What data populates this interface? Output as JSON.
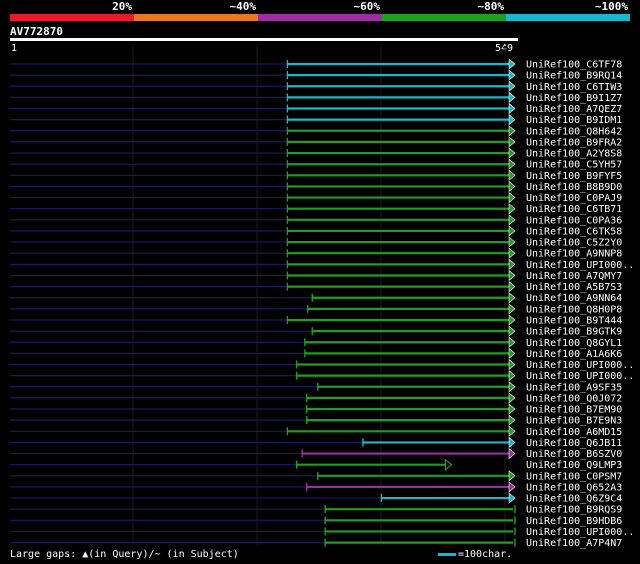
{
  "legend": {
    "segments": [
      {
        "label": "20%",
        "color": "#e8192c"
      },
      {
        "label": "~40%",
        "color": "#e87722"
      },
      {
        "label": "~60%",
        "color": "#9b2fa0"
      },
      {
        "label": "~80%",
        "color": "#1f9e1f"
      },
      {
        "label": "~100%",
        "color": "#17b8c8"
      }
    ]
  },
  "query": {
    "name": "AV772870",
    "start": "1",
    "end": "549"
  },
  "colors": {
    "connector": "#1a1a66",
    "cyan": "#17b8c8",
    "green": "#1f9e1f",
    "purple": "#9b2fa0"
  },
  "hits": [
    {
      "label": "UniRef100_C6TF78",
      "color": "cyan",
      "start": 302,
      "end": 549,
      "end_marker": "arrow"
    },
    {
      "label": "UniRef100_B9RQ14",
      "color": "cyan",
      "start": 302,
      "end": 549,
      "end_marker": "arrow"
    },
    {
      "label": "UniRef100_C6TIW3",
      "color": "cyan",
      "start": 302,
      "end": 549,
      "end_marker": "arrow"
    },
    {
      "label": "UniRef100_B9I1Z7",
      "color": "cyan",
      "start": 302,
      "end": 549,
      "end_marker": "arrow"
    },
    {
      "label": "UniRef100_A7QEZ7",
      "color": "cyan",
      "start": 302,
      "end": 549,
      "end_marker": "arrow"
    },
    {
      "label": "UniRef100_B9IDM1",
      "color": "cyan",
      "start": 302,
      "end": 549,
      "end_marker": "arrow"
    },
    {
      "label": "UniRef100_Q8H642",
      "color": "green",
      "start": 302,
      "end": 549,
      "end_marker": "arrow"
    },
    {
      "label": "UniRef100_B9FRA2",
      "color": "green",
      "start": 302,
      "end": 549,
      "end_marker": "arrow"
    },
    {
      "label": "UniRef100_A2Y8S8",
      "color": "green",
      "start": 302,
      "end": 549,
      "end_marker": "arrow"
    },
    {
      "label": "UniRef100_C5YH57",
      "color": "green",
      "start": 302,
      "end": 549,
      "end_marker": "arrow"
    },
    {
      "label": "UniRef100_B9FYF5",
      "color": "green",
      "start": 302,
      "end": 549,
      "end_marker": "arrow"
    },
    {
      "label": "UniRef100_B8B9D0",
      "color": "green",
      "start": 302,
      "end": 549,
      "end_marker": "arrow"
    },
    {
      "label": "UniRef100_C0PAJ9",
      "color": "green",
      "start": 302,
      "end": 549,
      "end_marker": "arrow"
    },
    {
      "label": "UniRef100_C6TB71",
      "color": "green",
      "start": 302,
      "end": 549,
      "end_marker": "arrow"
    },
    {
      "label": "UniRef100_C0PA36",
      "color": "green",
      "start": 302,
      "end": 549,
      "end_marker": "arrow"
    },
    {
      "label": "UniRef100_C6TK58",
      "color": "green",
      "start": 302,
      "end": 549,
      "end_marker": "arrow"
    },
    {
      "label": "UniRef100_C5Z2Y0",
      "color": "green",
      "start": 302,
      "end": 549,
      "end_marker": "arrow"
    },
    {
      "label": "UniRef100_A9NNP8",
      "color": "green",
      "start": 302,
      "end": 549,
      "end_marker": "arrow"
    },
    {
      "label": "UniRef100_UPI000..",
      "color": "green",
      "start": 302,
      "end": 549,
      "end_marker": "arrow"
    },
    {
      "label": "UniRef100_A7QMY7",
      "color": "green",
      "start": 302,
      "end": 549,
      "end_marker": "arrow"
    },
    {
      "label": "UniRef100_A5B7S3",
      "color": "green",
      "start": 302,
      "end": 549,
      "end_marker": "arrow"
    },
    {
      "label": "UniRef100_A9NN64",
      "color": "green",
      "start": 329,
      "end": 549,
      "end_marker": "arrow"
    },
    {
      "label": "UniRef100_Q8H0P8",
      "color": "green",
      "start": 324,
      "end": 549,
      "end_marker": "arrow"
    },
    {
      "label": "UniRef100_B9T444",
      "color": "green",
      "start": 302,
      "end": 549,
      "end_marker": "arrow"
    },
    {
      "label": "UniRef100_B9GTK9",
      "color": "green",
      "start": 329,
      "end": 549,
      "end_marker": "arrow"
    },
    {
      "label": "UniRef100_Q8GYL1",
      "color": "green",
      "start": 321,
      "end": 549,
      "end_marker": "arrow"
    },
    {
      "label": "UniRef100_A1A6K6",
      "color": "green",
      "start": 321,
      "end": 549,
      "end_marker": "arrow"
    },
    {
      "label": "UniRef100_UPI000..",
      "color": "green",
      "start": 312,
      "end": 549,
      "end_marker": "arrow"
    },
    {
      "label": "UniRef100_UPI000..",
      "color": "green",
      "start": 312,
      "end": 549,
      "end_marker": "arrow"
    },
    {
      "label": "UniRef100_A9SF35",
      "color": "green",
      "start": 335,
      "end": 549,
      "end_marker": "arrow"
    },
    {
      "label": "UniRef100_Q0J072",
      "color": "green",
      "start": 323,
      "end": 549,
      "end_marker": "arrow"
    },
    {
      "label": "UniRef100_B7EM90",
      "color": "green",
      "start": 323,
      "end": 549,
      "end_marker": "arrow"
    },
    {
      "label": "UniRef100_B7E9N3",
      "color": "green",
      "start": 323,
      "end": 549,
      "end_marker": "arrow"
    },
    {
      "label": "UniRef100_A6MD15",
      "color": "green",
      "start": 302,
      "end": 549,
      "end_marker": "arrow"
    },
    {
      "label": "UniRef100_Q6JB11",
      "color": "cyan",
      "start": 384,
      "end": 549,
      "end_marker": "arrow"
    },
    {
      "label": "UniRef100_B6SZV0",
      "color": "purple",
      "start": 318,
      "end": 549,
      "end_marker": "arrow"
    },
    {
      "label": "UniRef100_Q9LMP3",
      "color": "green",
      "start": 312,
      "end": 480,
      "end_marker": "open-arrow"
    },
    {
      "label": "UniRef100_C0PSM7",
      "color": "green",
      "start": 335,
      "end": 549,
      "end_marker": "arrow"
    },
    {
      "label": "UniRef100_Q652A3",
      "color": "purple",
      "start": 323,
      "end": 549,
      "end_marker": "arrow"
    },
    {
      "label": "UniRef100_Q6Z9C4",
      "color": "cyan",
      "start": 404,
      "end": 549,
      "end_marker": "arrow"
    },
    {
      "label": "UniRef100_B9RQS9",
      "color": "green",
      "start": 343,
      "end": 549,
      "end_marker": "bar"
    },
    {
      "label": "UniRef100_B9HDB6",
      "color": "green",
      "start": 343,
      "end": 549,
      "end_marker": "bar"
    },
    {
      "label": "UniRef100_UPI000..",
      "color": "green",
      "start": 343,
      "end": 549,
      "end_marker": "bar"
    },
    {
      "label": "UniRef100_A7P4N7",
      "color": "green",
      "start": 343,
      "end": 549,
      "end_marker": "bar"
    }
  ],
  "footer": {
    "gaps_text": "Large gaps: ▲(in Query)/~ (in Subject)",
    "scale_text": "=100char."
  }
}
